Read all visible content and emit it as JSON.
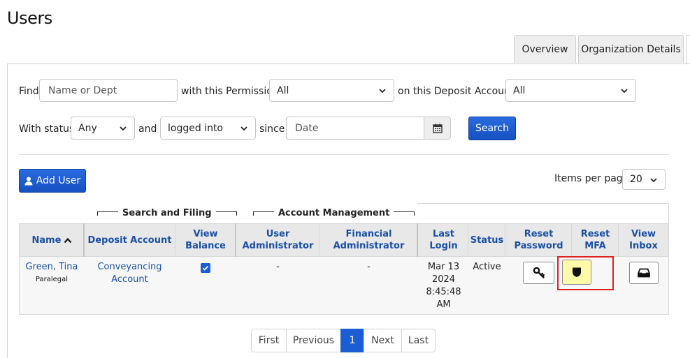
{
  "page": {
    "title": "Users"
  },
  "tabs": [
    {
      "label": "Overview"
    },
    {
      "label": "Organization Details"
    }
  ],
  "filters": {
    "find_label": "Find",
    "find_placeholder": "Name or Dept",
    "permission_label": "with this Permission",
    "permission_value": "All",
    "deposit_label": "on this Deposit Account",
    "deposit_value": "All",
    "status_label": "With status",
    "status_value": "Any",
    "and_label": "and",
    "login_value": "logged into",
    "since_label": "since",
    "date_placeholder": "Date",
    "search_label": "Search"
  },
  "toolbar": {
    "add_user_label": "Add User",
    "items_per_page_label": "Items per page",
    "items_per_page_value": "20"
  },
  "table": {
    "groups": {
      "search_filing": "Search and Filing",
      "account_management": "Account Management"
    },
    "headers": {
      "name": "Name",
      "deposit_account": "Deposit Account",
      "view_balance_1": "View",
      "view_balance_2": "Balance",
      "user_admin_1": "User",
      "user_admin_2": "Administrator",
      "fin_admin_1": "Financial",
      "fin_admin_2": "Administrator",
      "last_login_1": "Last",
      "last_login_2": "Login",
      "status": "Status",
      "reset_password_1": "Reset",
      "reset_password_2": "Password",
      "reset_mfa_1": "Reset",
      "reset_mfa_2": "MFA",
      "view_inbox_1": "View",
      "view_inbox_2": "Inbox"
    },
    "rows": [
      {
        "name": "Green, Tina",
        "role": "Paralegal",
        "deposit_1": "Conveyancing",
        "deposit_2": "Account",
        "view_balance": true,
        "user_admin": "-",
        "fin_admin": "-",
        "login_1": "Mar 13",
        "login_2": "2024",
        "login_3": "8:45:48",
        "login_4": "AM",
        "status": "Active"
      }
    ]
  },
  "pagination": {
    "first": "First",
    "previous": "Previous",
    "current": "1",
    "next": "Next",
    "last": "Last"
  },
  "colors": {
    "primary": "#1b5dd3",
    "highlight": "#e0201c",
    "mfa_bg": "#fff9a8"
  }
}
